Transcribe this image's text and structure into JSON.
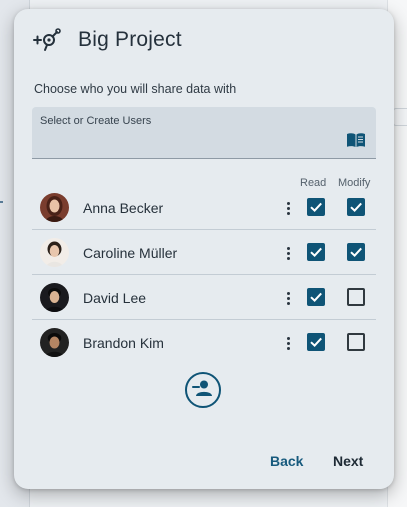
{
  "dialog": {
    "title": "Big Project",
    "project_icon": "add-person-tag-icon",
    "subtitle": "Choose who you will share data with",
    "user_select": {
      "label": "Select or Create Users",
      "icon": "book-icon"
    },
    "columns": {
      "read": "Read",
      "modify": "Modify"
    },
    "users": [
      {
        "name": "Anna Becker",
        "read": true,
        "modify": true,
        "avatar_color": "#8a4a3a"
      },
      {
        "name": "Caroline Müller",
        "read": true,
        "modify": true,
        "avatar_color": "#f2ede8"
      },
      {
        "name": "David Lee",
        "read": true,
        "modify": false,
        "avatar_color": "#1e1e22"
      },
      {
        "name": "Brandon Kim",
        "read": true,
        "modify": false,
        "avatar_color": "#262626"
      }
    ],
    "add_user_icon": "remove-person-icon",
    "actions": {
      "back_label": "Back",
      "next_label": "Next"
    },
    "colors": {
      "accent": "#0f5476",
      "dialog_bg": "#e6ebef"
    }
  }
}
